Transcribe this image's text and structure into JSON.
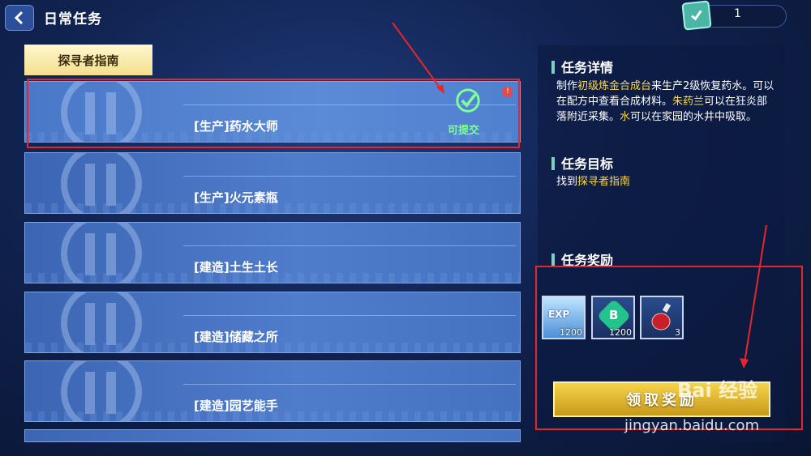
{
  "header": {
    "title": "日常任务",
    "counter_value": "1"
  },
  "tab": {
    "label": "探寻者指南"
  },
  "quests": [
    {
      "label": "[生产]药水大师",
      "status": "可提交"
    },
    {
      "label": "[生产]火元素瓶"
    },
    {
      "label": "[建造]土生土长"
    },
    {
      "label": "[建造]储藏之所"
    },
    {
      "label": "[建造]园艺能手"
    }
  ],
  "details": {
    "title": "任务详情",
    "parts": [
      "制作",
      "初级炼金合成台",
      "来生产2级恢复药水。可以在配方中查看合成材料。",
      "朱药兰",
      "可以在狂炎部落附近采集。",
      "水",
      "可以在家园的水井中吸取。"
    ]
  },
  "goal": {
    "title": "任务目标",
    "prefix": "找到",
    "target": "探寻者指南"
  },
  "rewards": {
    "title": "任务奖励",
    "items": [
      {
        "icon": "exp-icon",
        "badge": "EXP",
        "count": "1200"
      },
      {
        "icon": "b-coin-icon",
        "badge": "B",
        "count": "1200"
      },
      {
        "icon": "potion-icon",
        "count": "3"
      }
    ]
  },
  "claim_button": "领取奖励",
  "watermark": {
    "logo": "Bai 经验",
    "url": "jingyan.baidu.com"
  },
  "colors": {
    "highlight": "#ffd94a",
    "annotation_red": "#e8262a",
    "accent_teal": "#7ad1c2"
  }
}
